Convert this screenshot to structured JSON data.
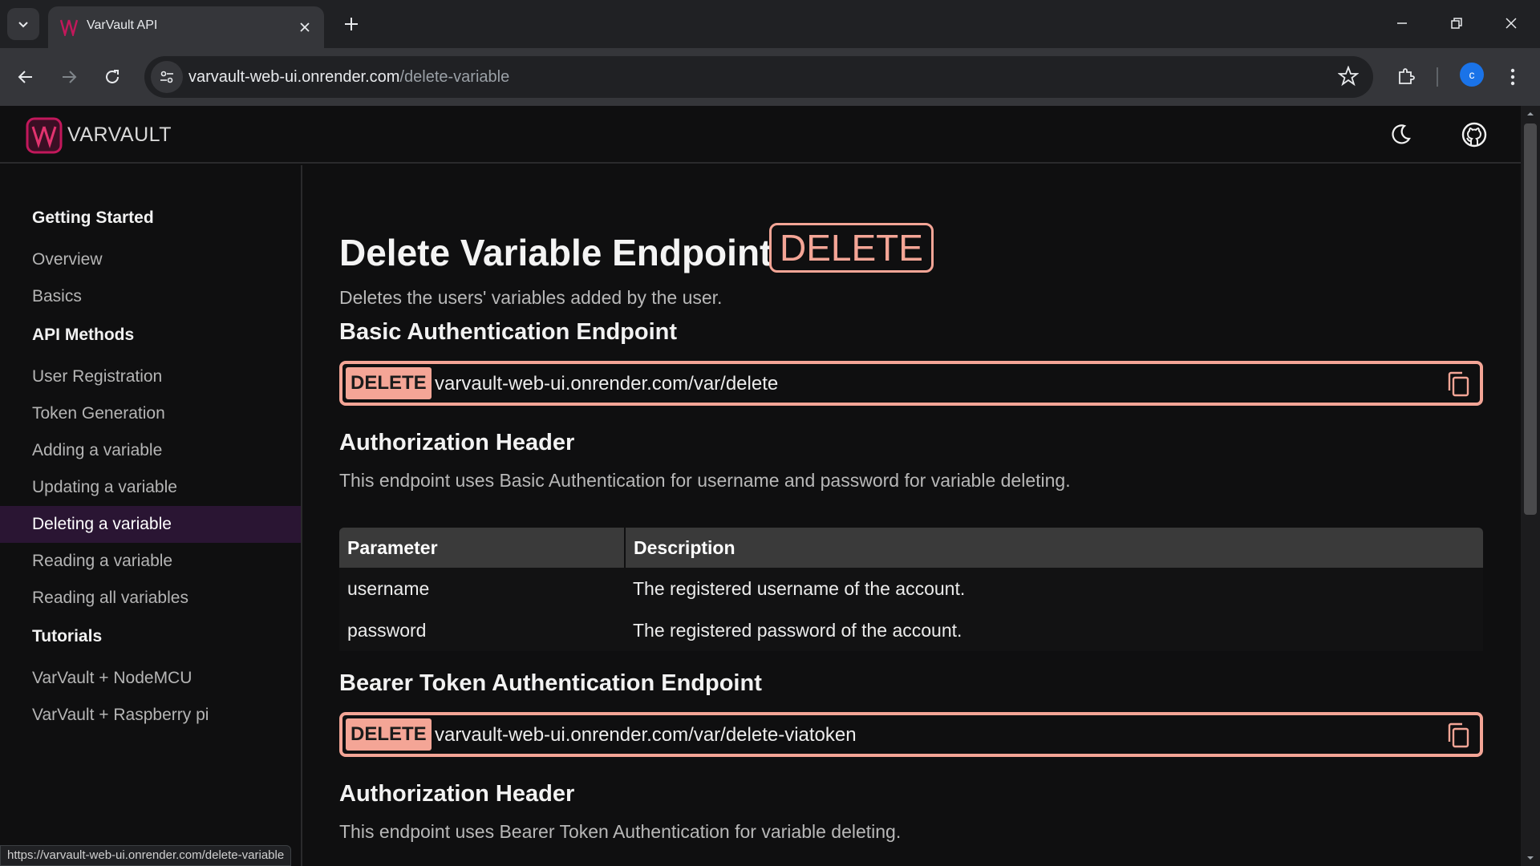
{
  "browser": {
    "tab_title": "VarVault API",
    "url_host": "varvault-web-ui.onrender.com",
    "url_path": "/delete-variable",
    "profile_initial": "c",
    "status_url": "https://varvault-web-ui.onrender.com/delete-variable"
  },
  "header": {
    "brand": "VARVAULT"
  },
  "sidebar": {
    "sections": [
      {
        "title": "Getting Started",
        "items": [
          "Overview",
          "Basics"
        ]
      },
      {
        "title": "API Methods",
        "items": [
          "User Registration",
          "Token Generation",
          "Adding a variable",
          "Updating a variable",
          "Deleting a variable",
          "Reading a variable",
          "Reading all variables"
        ]
      },
      {
        "title": "Tutorials",
        "items": [
          "VarVault + NodeMCU",
          "VarVault + Raspberry pi"
        ]
      }
    ],
    "active_item": "Deleting a variable"
  },
  "main": {
    "title": "Delete Variable Endpoint",
    "method": "DELETE",
    "description": "Deletes the users' variables added by the user.",
    "basic": {
      "heading": "Basic Authentication Endpoint",
      "verb": "DELETE",
      "endpoint": "varvault-web-ui.onrender.com/var/delete",
      "auth_heading": "Authorization Header",
      "auth_desc": "This endpoint uses Basic Authentication for username and password for variable deleting.",
      "table": {
        "headers": [
          "Parameter",
          "Description"
        ],
        "rows": [
          [
            "username",
            "The registered username of the account."
          ],
          [
            "password",
            "The registered password of the account."
          ]
        ]
      }
    },
    "bearer": {
      "heading": "Bearer Token Authentication Endpoint",
      "verb": "DELETE",
      "endpoint": "varvault-web-ui.onrender.com/var/delete-viatoken",
      "auth_heading": "Authorization Header",
      "auth_desc": "This endpoint uses Bearer Token Authentication for variable deleting."
    }
  },
  "colors": {
    "accent": "#f4a596",
    "active_bg": "#2a1533",
    "brand_logo": "#c2185b"
  }
}
